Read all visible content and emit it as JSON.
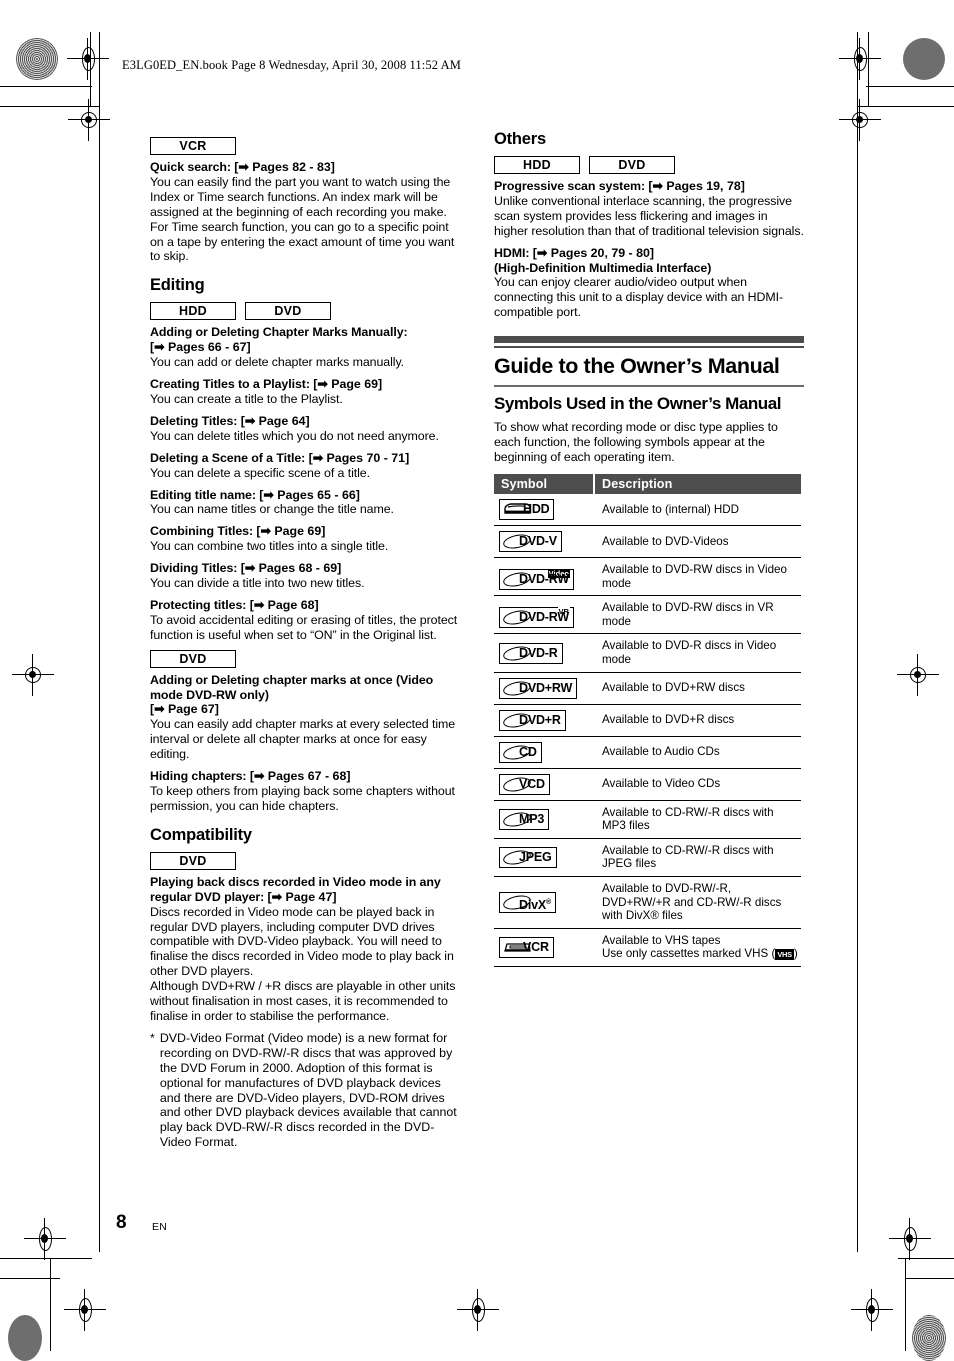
{
  "header": {
    "file_line": "E3LG0ED_EN.book  Page 8  Wednesday, April 30, 2008  11:52 AM"
  },
  "footer": {
    "page_number": "8",
    "language": "EN"
  },
  "left_column": {
    "vcr_block": {
      "chips": [
        "VCR"
      ],
      "entries": [
        {
          "lead": "Quick search:",
          "ref": "[➡ Pages 82 - 83]",
          "text": "You can easily find the part you want to watch using the Index or Time search functions. An index mark will be assigned at the beginning of each recording you make. For Time search function, you can go to a specific point on a tape by entering the exact amount of time you want to skip."
        }
      ]
    },
    "editing": {
      "heading": "Editing",
      "chips": [
        "HDD",
        "DVD"
      ],
      "entries": [
        {
          "lead": "Adding or Deleting Chapter Marks Manually:",
          "ref": "[➡ Pages 66 - 67]",
          "ref_on_new_line": true,
          "text": "You can add or delete chapter marks manually."
        },
        {
          "lead": "Creating Titles to a Playlist:",
          "ref": "[➡ Page 69]",
          "text": "You can create a title to the Playlist."
        },
        {
          "lead": "Deleting Titles:",
          "ref": "[➡ Page 64]",
          "text": "You can delete titles which you do not need anymore."
        },
        {
          "lead": "Deleting a Scene of a Title:",
          "ref": "[➡ Pages 70 - 71]",
          "text": "You can delete a specific scene of a title."
        },
        {
          "lead": "Editing title name:",
          "ref": "[➡ Pages 65 - 66]",
          "text": "You can name titles or change the title name."
        },
        {
          "lead": "Combining Titles:",
          "ref": "[➡ Page 69]",
          "text": "You can combine two titles into a single title."
        },
        {
          "lead": "Dividing Titles:",
          "ref": "[➡ Pages 68 - 69]",
          "text": "You can divide a title into two new titles."
        },
        {
          "lead": "Protecting titles:",
          "ref": "[➡ Page 68]",
          "text": "To avoid accidental editing or erasing of titles, the protect function is useful when set to “ON” in the Original list."
        }
      ]
    },
    "dvd_block": {
      "chips": [
        "DVD"
      ],
      "entries": [
        {
          "lead": "Adding or Deleting chapter marks at once (Video mode DVD-RW only)",
          "ref": "[➡ Page 67]",
          "ref_on_new_line": true,
          "text": "You can easily add chapter marks at every selected time interval or delete all chapter marks at once for easy editing."
        },
        {
          "lead": "Hiding chapters:",
          "ref": "[➡ Pages 67 - 68]",
          "text": "To keep others from playing back some chapters without permission, you can hide chapters."
        }
      ]
    },
    "compatibility": {
      "heading": "Compatibility",
      "chips": [
        "DVD"
      ],
      "entries": [
        {
          "lead": "Playing back discs recorded in Video mode in any regular DVD player:",
          "ref": "[➡ Page 47]",
          "text": "Discs recorded in Video mode can be played back in regular DVD players, including computer DVD drives compatible with DVD-Video playback. You will need to finalise the discs recorded in Video mode to play back in other DVD players."
        },
        {
          "lead": "",
          "ref": "",
          "text": "Although DVD+RW / +R discs are playable in other units without finalisation in most cases, it is recommended to finalise in order to stabilise the performance."
        }
      ],
      "footnote_marker": "*",
      "footnote": "DVD-Video Format (Video mode) is a new format for recording on DVD-RW/-R discs that was approved by the DVD Forum in 2000. Adoption of this format is optional for manufactures of DVD playback devices and there are DVD-Video players, DVD-ROM drives and other DVD playback devices available that cannot play back DVD-RW/-R discs recorded in the DVD-Video Format."
    }
  },
  "right_column": {
    "others": {
      "heading": "Others",
      "chips": [
        "HDD",
        "DVD"
      ],
      "entries": [
        {
          "lead": "Progressive scan system:",
          "ref": "[➡ Pages 19, 78]",
          "text": "Unlike conventional interlace scanning, the progressive scan system provides less flickering and images in higher resolution than that of traditional television signals."
        },
        {
          "lead": "HDMI:",
          "ref": "[➡ Pages 20, 79 - 80]",
          "subtitle": "(High-Definition Multimedia Interface)",
          "text": "You can enjoy clearer audio/video output when connecting this unit to a display device with an HDMI-compatible port."
        }
      ]
    },
    "guide": {
      "title": "Guide to the Owner’s Manual",
      "section_title": "Symbols Used in the Owner’s Manual",
      "intro": "To show what recording mode or disc type applies to each function, the following symbols appear at the beginning of each operating item.",
      "table": {
        "headers": [
          "Symbol",
          "Description"
        ],
        "rows": [
          {
            "symbol_label": "HDD",
            "symbol_sup": "",
            "symbol_kind": "hw-hdd",
            "description": "Available to (internal) HDD"
          },
          {
            "symbol_label": "DVD-V",
            "symbol_sup": "",
            "symbol_kind": "disc",
            "description": "Available to DVD-Videos"
          },
          {
            "symbol_label": "DVD-RW",
            "symbol_sup": "Video",
            "symbol_kind": "disc",
            "sup_inverse": true,
            "description": "Available to DVD-RW discs in Video mode"
          },
          {
            "symbol_label": "DVD-RW",
            "symbol_sup": "VR",
            "symbol_kind": "disc",
            "description": "Available to DVD-RW discs in VR mode"
          },
          {
            "symbol_label": "DVD-R",
            "symbol_sup": "",
            "symbol_kind": "disc",
            "description": "Available to DVD-R discs in Video mode"
          },
          {
            "symbol_label": "DVD+RW",
            "symbol_sup": "",
            "symbol_kind": "disc",
            "description": "Available to DVD+RW discs"
          },
          {
            "symbol_label": "DVD+R",
            "symbol_sup": "",
            "symbol_kind": "disc",
            "description": "Available to DVD+R discs"
          },
          {
            "symbol_label": "CD",
            "symbol_sup": "",
            "symbol_kind": "disc",
            "description": "Available to Audio CDs"
          },
          {
            "symbol_label": "VCD",
            "symbol_sup": "",
            "symbol_kind": "disc",
            "description": "Available to Video CDs"
          },
          {
            "symbol_label": "MP3",
            "symbol_sup": "",
            "symbol_kind": "disc",
            "description": "Available to CD-RW/-R discs with MP3 files"
          },
          {
            "symbol_label": "JPEG",
            "symbol_sup": "",
            "symbol_kind": "disc",
            "description": "Available to CD-RW/-R discs with JPEG files"
          },
          {
            "symbol_label": "DivX",
            "symbol_sup": "",
            "symbol_kind": "disc",
            "symbol_reg": "®",
            "description": "Available to DVD-RW/-R, DVD+RW/+R and CD-RW/-R discs with DivX® files"
          },
          {
            "symbol_label": "VCR",
            "symbol_sup": "",
            "symbol_kind": "hw-vcr",
            "description_line1": "Available to VHS tapes",
            "description_line2_pre": "Use only cassettes marked VHS (",
            "description_line2_logo": "VHS",
            "description_line2_post": ")"
          }
        ]
      }
    }
  },
  "colors": {
    "rule": "#4d4d4d",
    "table_header_bg": "#4d4d4d",
    "text": "#000000"
  }
}
